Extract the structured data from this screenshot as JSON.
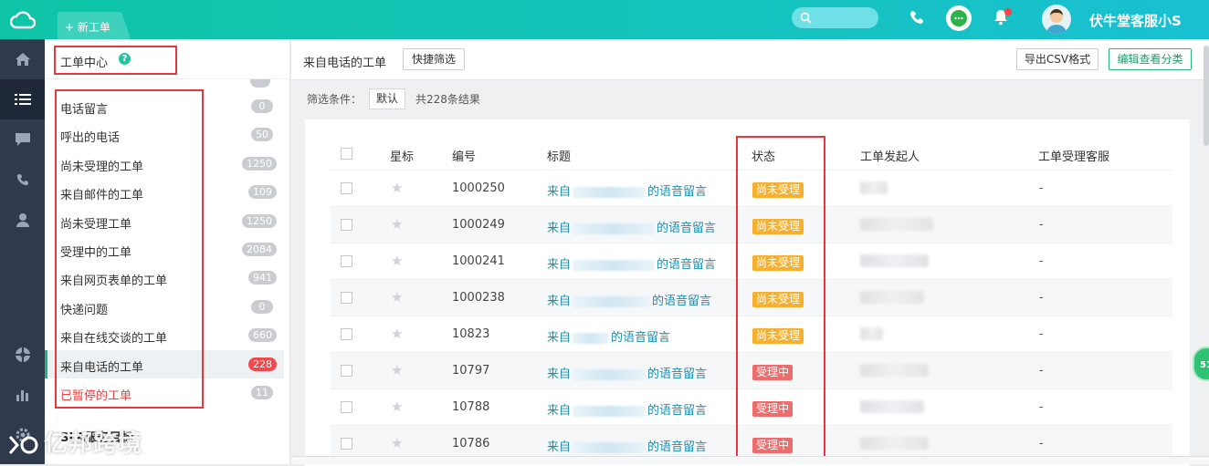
{
  "header": {
    "new_tab_label": "+ 新工单",
    "user_name": "伏牛堂客服小S",
    "accent": "#14c3bd"
  },
  "leftnav": {
    "icons": [
      "home-icon",
      "list-icon",
      "chat-icon",
      "phone-icon",
      "user-icon",
      "globe-icon",
      "bar-chart-icon",
      "settings-icon"
    ],
    "active_index": 1
  },
  "sidebar": {
    "title": "工单中心",
    "help_icon": "?",
    "items": [
      {
        "label": "电话留言",
        "count": "0"
      },
      {
        "label": "呼出的电话",
        "count": "50"
      },
      {
        "label": "尚未受理的工单",
        "count": "1250"
      },
      {
        "label": "来自邮件的工单",
        "count": "109"
      },
      {
        "label": "尚未受理工单",
        "count": "1250"
      },
      {
        "label": "受理中的工单",
        "count": "2084"
      },
      {
        "label": "来自网页表单的工单",
        "count": "941"
      },
      {
        "label": "快递问题",
        "count": "0"
      },
      {
        "label": "来自在线交谈的工单",
        "count": "660"
      },
      {
        "label": "来自电话的工单",
        "count": "228"
      },
      {
        "label": "已暂停的工单",
        "count": "11"
      }
    ],
    "section_label": "SLA服务目标"
  },
  "content": {
    "title": "来自电话的工单",
    "quick_filter": "快捷筛选",
    "export_csv": "导出CSV格式",
    "edit_view": "编辑查看分类",
    "filter_label": "筛选条件：",
    "filter_default": "默认",
    "total": "共228条结果"
  },
  "table": {
    "columns": [
      "星标",
      "编号",
      "标题",
      "状态",
      "工单发起人",
      "工单受理客服"
    ],
    "rows": [
      {
        "id": "1000250",
        "title_prefix": "来自",
        "title_suffix": "的语音留言",
        "status": "尚未受理",
        "status_type": "pending",
        "agent": "-"
      },
      {
        "id": "1000249",
        "title_prefix": "来自",
        "title_suffix": "的语音留言",
        "status": "尚未受理",
        "status_type": "pending",
        "agent": "-"
      },
      {
        "id": "1000241",
        "title_prefix": "来自",
        "title_suffix": "的语音留言",
        "status": "尚未受理",
        "status_type": "pending",
        "agent": "-"
      },
      {
        "id": "1000238",
        "title_prefix": "来自",
        "title_suffix": "的语音留言",
        "status": "尚未受理",
        "status_type": "pending",
        "agent": "-"
      },
      {
        "id": "10823",
        "title_prefix": "来自",
        "title_suffix": "的语音留言",
        "status": "尚未受理",
        "status_type": "pending",
        "agent": "-"
      },
      {
        "id": "10797",
        "title_prefix": "来自",
        "title_suffix": "的语音留言",
        "status": "受理中",
        "status_type": "inprog",
        "agent": "-"
      },
      {
        "id": "10788",
        "title_prefix": "来自",
        "title_suffix": "的语音留言",
        "status": "受理中",
        "status_type": "inprog",
        "agent": "-"
      },
      {
        "id": "10786",
        "title_prefix": "来自",
        "title_suffix": "的语音留言",
        "status": "受理中",
        "status_type": "inprog",
        "agent": "-"
      }
    ]
  },
  "floating_badge": "51",
  "watermark": "亿邦跨境",
  "colors": {
    "pending": "#f6b02f",
    "inprog": "#ef6c6c",
    "highlight": "#e8373d",
    "link": "#1a8fb0"
  }
}
